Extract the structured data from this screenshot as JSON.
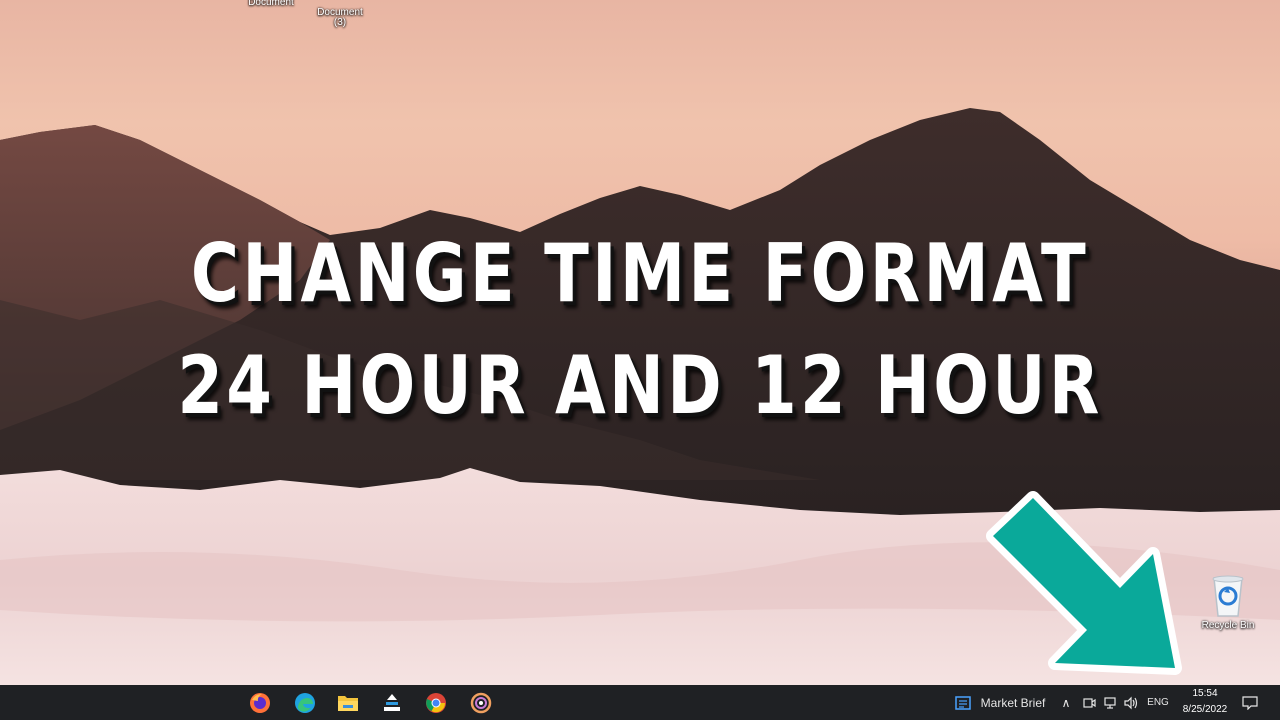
{
  "desktop": {
    "icons": [
      {
        "label": "Document"
      },
      {
        "label": "Document\n(3)"
      }
    ],
    "overlay_title": {
      "line1": "CHANGE TIME FORMAT",
      "line2": "24 HOUR AND 12 HOUR"
    },
    "recycle_bin": {
      "label": "Recycle Bin",
      "icon": "recycle-bin-icon"
    },
    "arrow": {
      "color": "#0aa99a",
      "icon": "arrow-down-right-icon"
    }
  },
  "taskbar": {
    "apps": [
      {
        "name": "Firefox",
        "icon": "firefox-icon"
      },
      {
        "name": "Microsoft Edge",
        "icon": "edge-icon"
      },
      {
        "name": "File Explorer",
        "icon": "folder-icon"
      },
      {
        "name": "Store",
        "icon": "store-icon"
      },
      {
        "name": "Google Chrome",
        "icon": "chrome-icon"
      },
      {
        "name": "Media",
        "icon": "media-icon"
      }
    ],
    "news_widget": {
      "label": "Market Brief",
      "icon": "news-icon"
    },
    "tray": {
      "language": "ENG",
      "time": "15:54",
      "date": "8/25/2022"
    }
  }
}
